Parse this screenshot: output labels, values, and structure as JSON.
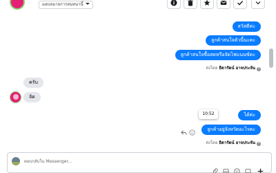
{
  "header": {
    "assign_label": "มอบหมายการสนทนานี้",
    "buttons": [
      "info-icon",
      "trash-icon",
      "star-icon",
      "mail-icon",
      "check-icon",
      "chevron-down-icon"
    ]
  },
  "messages": {
    "outgoing_1": "สวัสดีค่ะ",
    "outgoing_2": "ลูกค้าสนใจตัวนี้นะคะ",
    "outgoing_3": "ลูกค้าสนใจซื้อสดหรือจัดไฟแนนซ์คะ",
    "incoming_1": "ครับ",
    "incoming_2": "จัด",
    "outgoing_4": "ได้ค่ะ",
    "outgoing_5": "ลูกค้าอยู่จังหวัดอะไรคะ"
  },
  "sent_by": {
    "prefix": "ส่งโดย",
    "name_1": "ธิดารัตน์ อาจประจัน",
    "name_2": "ธิดารัตน์ อาจประจัน"
  },
  "tooltip_time": "10:52",
  "composer": {
    "placeholder": "ตอบกลับใน Messenger..."
  },
  "colors": {
    "outgoing_bubble": "#0a7cff",
    "incoming_bubble": "#e4e6eb",
    "avatar": "#e41f75"
  }
}
